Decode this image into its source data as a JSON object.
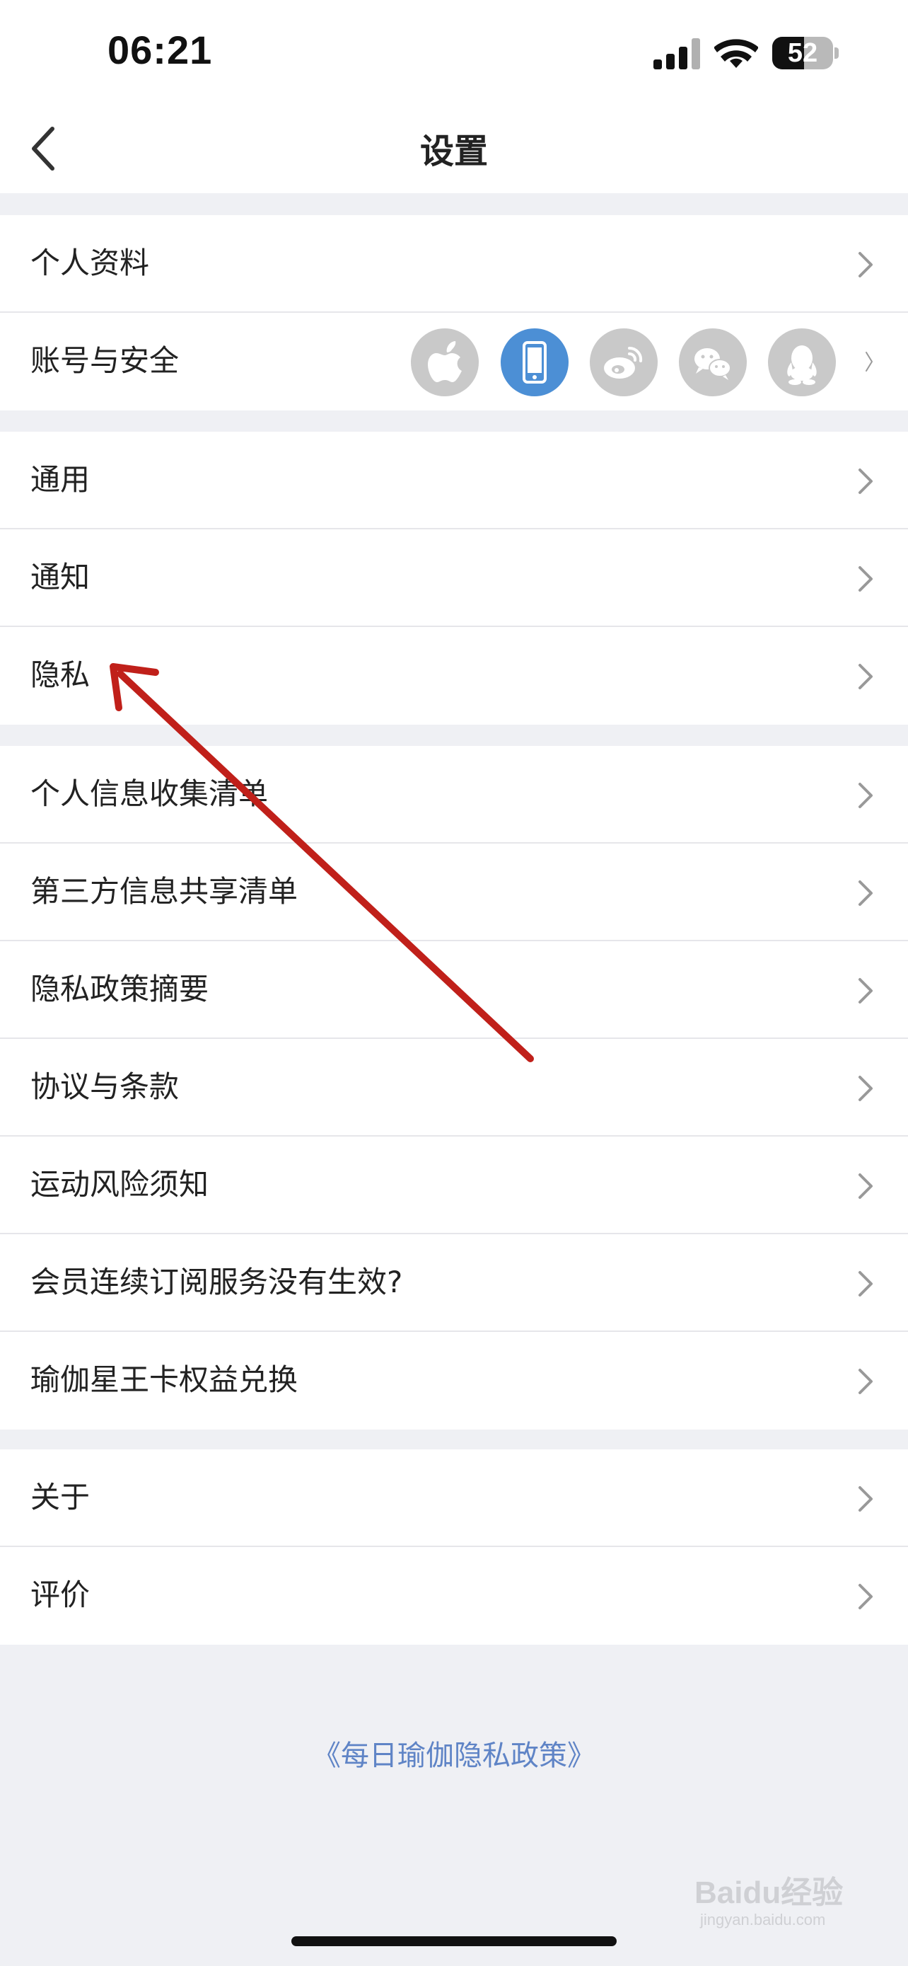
{
  "status_bar": {
    "time": "06:21",
    "battery": "52",
    "battery_level_percent": 52
  },
  "nav": {
    "title": "设置"
  },
  "groups": [
    {
      "items": [
        {
          "label": "个人资料"
        },
        {
          "label": "账号与安全"
        }
      ]
    },
    {
      "items": [
        {
          "label": "通用"
        },
        {
          "label": "通知"
        },
        {
          "label": "隐私"
        }
      ]
    },
    {
      "items": [
        {
          "label": "个人信息收集清单"
        },
        {
          "label": "第三方信息共享清单"
        },
        {
          "label": "隐私政策摘要"
        },
        {
          "label": "协议与条款"
        },
        {
          "label": "运动风险须知"
        },
        {
          "label": "会员连续订阅服务没有生效?"
        },
        {
          "label": "瑜伽星王卡权益兑换"
        }
      ]
    },
    {
      "items": [
        {
          "label": "关于"
        },
        {
          "label": "评价"
        }
      ]
    }
  ],
  "account_bindings": [
    {
      "icon": "apple-icon",
      "active": false
    },
    {
      "icon": "phone-icon",
      "active": true
    },
    {
      "icon": "weibo-icon",
      "active": false
    },
    {
      "icon": "wechat-icon",
      "active": false
    },
    {
      "icon": "qq-icon",
      "active": false
    }
  ],
  "footer": {
    "policy_link": "《每日瑜伽隐私政策》"
  },
  "watermark": {
    "brand": "Baidu经验",
    "url": "jingyan.baidu.com"
  },
  "colors": {
    "background": "#eff0f4",
    "link": "#5f84c6",
    "active_binding": "#4c8fd5",
    "annotation_arrow": "#c0201a"
  }
}
